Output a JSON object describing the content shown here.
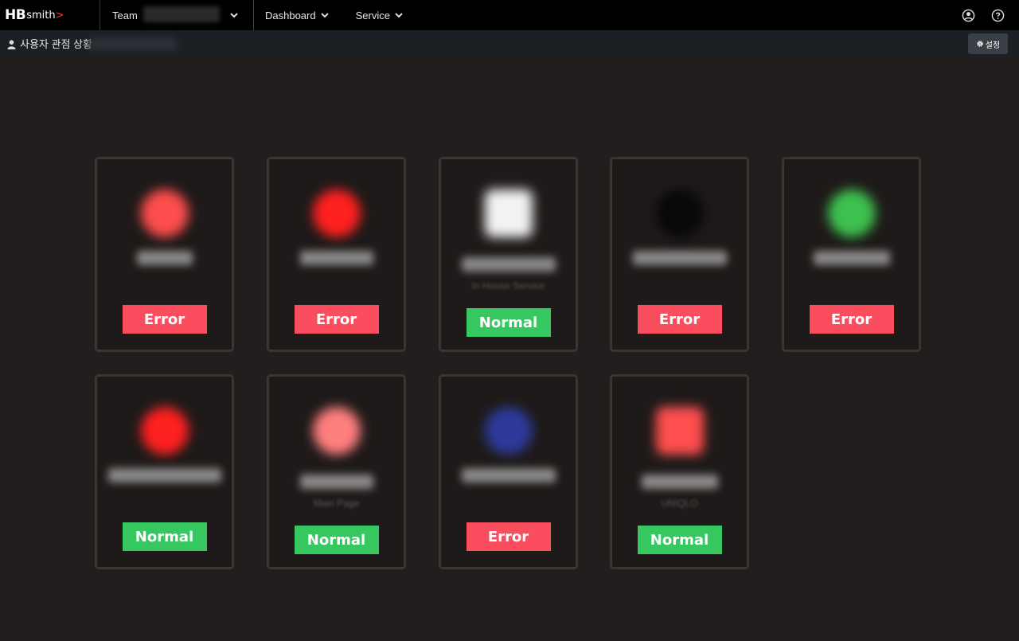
{
  "topnav": {
    "logo_hb": "HB",
    "logo_smith": "smith",
    "logo_mark": ">",
    "team_label": "Team",
    "dashboard_label": "Dashboard",
    "service_label": "Service"
  },
  "subbar": {
    "title": "사용자 관점 상황",
    "settings_label": "설정"
  },
  "cards": [
    {
      "status": "Error",
      "sub": "",
      "logo_color": "#ff4d4d"
    },
    {
      "status": "Error",
      "sub": "",
      "logo_color": "#ff2020"
    },
    {
      "status": "Normal",
      "sub": "In House Service",
      "logo_color": "#f2f2f2"
    },
    {
      "status": "Error",
      "sub": "",
      "logo_color": "#080808"
    },
    {
      "status": "Error",
      "sub": "",
      "logo_color": "#3ec04f"
    },
    {
      "status": "Normal",
      "sub": "",
      "logo_color": "#ff2020"
    },
    {
      "status": "Normal",
      "sub": "Main Page",
      "logo_color": "#ff7f7f"
    },
    {
      "status": "Error",
      "sub": "",
      "logo_color": "#2d3a9a"
    },
    {
      "status": "Normal",
      "sub": "UNIQLO",
      "logo_color": "#ff4f4f"
    }
  ],
  "colors": {
    "error": "#fa4e5e",
    "normal": "#36c761",
    "background": "#221e1d"
  }
}
